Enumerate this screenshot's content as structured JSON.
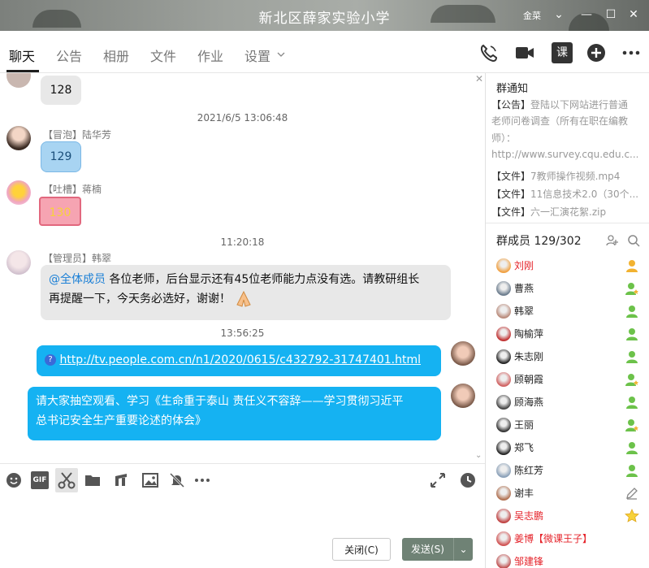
{
  "window": {
    "title": "新北区薛家实验小学",
    "corner_label": "金菜",
    "controls": [
      "⌄",
      "—",
      "☐",
      "✕"
    ]
  },
  "tabs": [
    {
      "label": "聊天"
    },
    {
      "label": "公告"
    },
    {
      "label": "相册"
    },
    {
      "label": "文件"
    },
    {
      "label": "作业"
    },
    {
      "label": "设置"
    }
  ],
  "nav_icons": [
    "phone-icon",
    "video-icon",
    "lesson-icon",
    "add-icon",
    "more-icon"
  ],
  "nav_lesson_label": "课",
  "chat": {
    "messages": [
      {
        "text": "128"
      },
      {
        "time": "2021/6/5 13:06:48"
      },
      {
        "sender": "【冒泡】陆华芳",
        "text": "129"
      },
      {
        "sender": "【吐槽】蒋楠",
        "text": "130"
      },
      {
        "time": "11:20:18"
      },
      {
        "sender": "【管理员】韩翠",
        "mention": "@全体成员",
        "line1": " 各位老师，后台显示还有45位老师能力点没有选。请教研组长",
        "line2": "再提醒一下，今天务必选好，谢谢！"
      },
      {
        "time": "13:56:25"
      },
      {
        "link": "http://tv.people.com.cn/n1/2020/0615/c432792-31747401.html"
      },
      {
        "line1": "请大家抽空观看、学习《生命重于泰山 责任义不容辞——学习贯彻习近平",
        "line2": "总书记安全生产重要论述的体会》"
      }
    ]
  },
  "notice": {
    "title": "群通知",
    "announcement_tag": "【公告】",
    "announcement_text": "登陆以下网站进行普通",
    "announcement_line2": "老师问卷调查（所有在职在编教",
    "announcement_line3": "师）：",
    "announcement_line4": "http://www.survey.cqu.edu.c...",
    "files": [
      {
        "tag": "【文件】",
        "name": "7教师操作视频.mp4"
      },
      {
        "tag": "【文件】",
        "name": "11信息技术2.0（30个..."
      },
      {
        "tag": "【文件】",
        "name": "六一汇演花絮.zip"
      }
    ]
  },
  "members": {
    "title": "群成员 129/302",
    "list": [
      {
        "name": "刘刚",
        "red": true,
        "role": "admin-icon",
        "color": "#f0a040"
      },
      {
        "name": "曹燕",
        "red": false,
        "role": "star-member-icon",
        "color": "#6a7b8c"
      },
      {
        "name": "韩翠",
        "red": false,
        "role": "member-icon",
        "color": "#b98a7a"
      },
      {
        "name": "陶榆萍",
        "red": false,
        "role": "member-icon",
        "color": "#c03030"
      },
      {
        "name": "朱志刚",
        "red": false,
        "role": "member-icon",
        "color": "#222222"
      },
      {
        "name": "顾朝霞",
        "red": false,
        "role": "star-member-icon",
        "color": "#d06060"
      },
      {
        "name": "顾海燕",
        "red": false,
        "role": "member-icon",
        "color": "#444444"
      },
      {
        "name": "王丽",
        "red": false,
        "role": "star-member-icon",
        "color": "#333333"
      },
      {
        "name": "郑飞",
        "red": false,
        "role": "member-icon",
        "color": "#222222"
      },
      {
        "name": "陈红芳",
        "red": false,
        "role": "member-icon",
        "color": "#8aa0b8"
      },
      {
        "name": "谢丰",
        "red": false,
        "role": "edit-icon",
        "color": "#b07050"
      },
      {
        "name": "吴志鹏",
        "red": true,
        "role": "star-icon",
        "color": "#c04040"
      },
      {
        "name": "姜博【微课王子】",
        "red": true,
        "role": "",
        "color": "#d05050"
      },
      {
        "name": "邹建锋",
        "red": true,
        "role": "",
        "color": "#c05050"
      }
    ]
  },
  "buttons": {
    "close": "关闭(C)",
    "send": "发送(S)",
    "send_arrow": "⌄"
  }
}
